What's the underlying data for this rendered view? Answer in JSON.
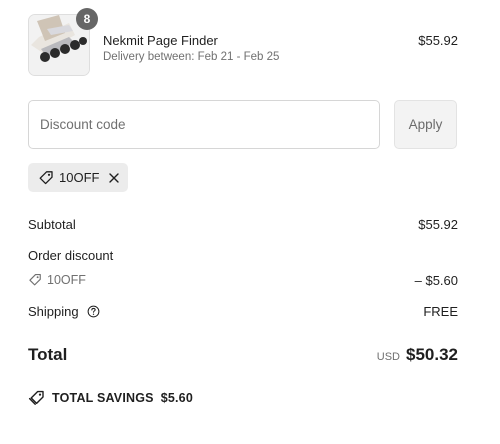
{
  "product": {
    "quantity": "8",
    "name": "Nekmit Page Finder",
    "delivery": "Delivery between: Feb 21 - Feb 25",
    "price": "$55.92"
  },
  "discount": {
    "placeholder": "Discount code",
    "apply_label": "Apply",
    "applied_code": "10OFF"
  },
  "summary": {
    "subtotal_label": "Subtotal",
    "subtotal_value": "$55.92",
    "order_discount_label": "Order discount",
    "discount_code": "10OFF",
    "discount_value": "– $5.60",
    "shipping_label": "Shipping",
    "shipping_value": "FREE",
    "total_label": "Total",
    "currency": "USD",
    "total_value": "$50.32",
    "savings_label": "TOTAL SAVINGS",
    "savings_value": "$5.60"
  },
  "icons": {
    "tag": "tag-icon",
    "remove": "close-icon",
    "help": "question-circle-icon",
    "savings": "double-tag-icon"
  },
  "colors": {
    "badge": "#666666",
    "muted_text": "#707070",
    "chip_bg": "#ececec"
  }
}
